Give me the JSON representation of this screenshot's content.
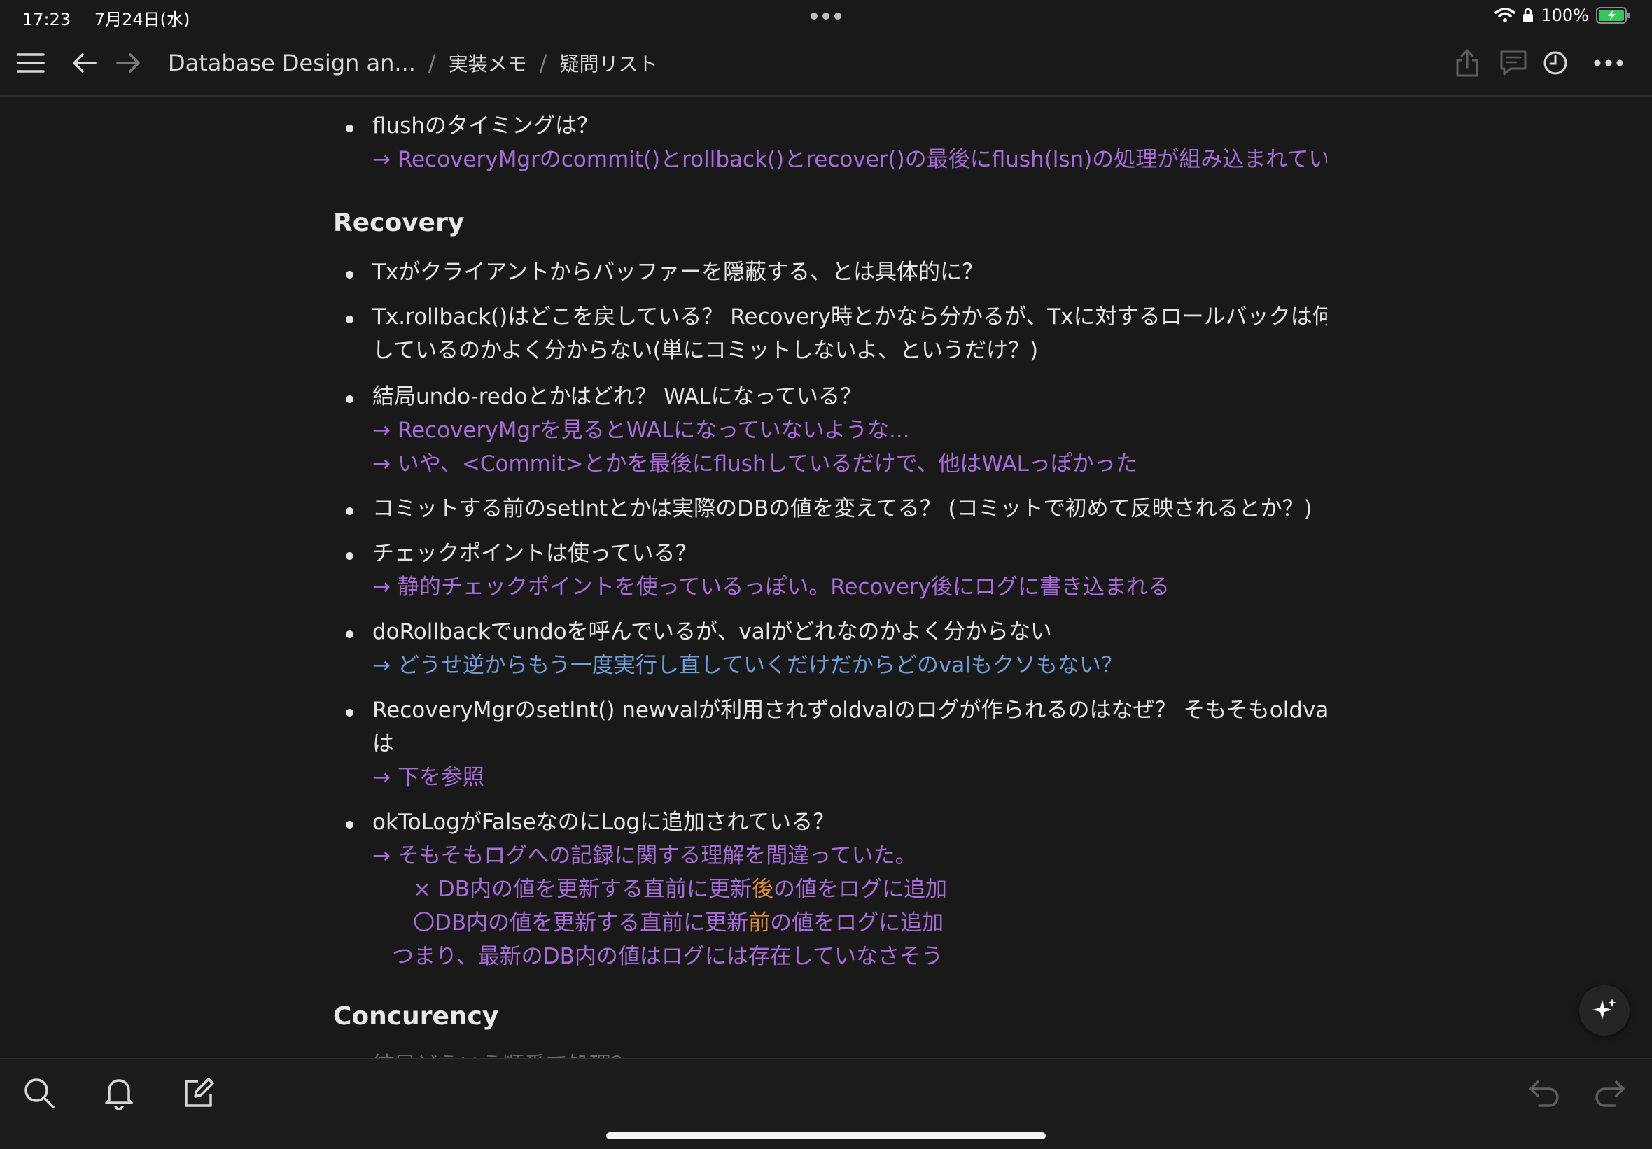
{
  "status_bar": {
    "time": "17:23",
    "date": "7月24日(水)",
    "battery": "100%"
  },
  "breadcrumb": {
    "root": "Database Design an...",
    "sep1": "/",
    "parent": "実装メモ",
    "sep2": "/",
    "current": "疑問リスト"
  },
  "content": {
    "items": [
      {
        "id": "l1",
        "kind": "bullet",
        "text": "flushのタイミングは？"
      },
      {
        "id": "l2",
        "kind": "answer",
        "text": "→ RecoveryMgrのcommit()とrollback()とrecover()の最後にflush(lsn)の処理が組み込まれている"
      },
      {
        "id": "h1",
        "kind": "heading",
        "text": "Recovery"
      },
      {
        "id": "l3",
        "kind": "bullet",
        "text": "Txがクライアントからバッファーを隠蔽する、とは具体的に？"
      },
      {
        "id": "l4",
        "kind": "bullet",
        "text": "Tx.rollback()はどこを戻している？ Recovery時とかなら分かるが、Txに対するロールバックは何を"
      },
      {
        "id": "l5",
        "kind": "cont",
        "text": "しているのかよく分からない(単にコミットしないよ、というだけ？)"
      },
      {
        "id": "l6",
        "kind": "bullet",
        "text": "結局undo-redoとかはどれ？ WALになっている？"
      },
      {
        "id": "l7",
        "kind": "answer",
        "text": "→ RecoveryMgrを見るとWALになっていないような..."
      },
      {
        "id": "l8",
        "kind": "answer",
        "text": "→ いや、<Commit>とかを最後にflushしているだけで、他はWALっぽかった"
      },
      {
        "id": "l9",
        "kind": "bullet",
        "text": "コミットする前のsetIntとかは実際のDBの値を変えてる？ (コミットで初めて反映されるとか？)"
      },
      {
        "id": "l10",
        "kind": "bullet",
        "text": "チェックポイントは使っている？"
      },
      {
        "id": "l11",
        "kind": "answer",
        "text": "→ 静的チェックポイントを使っているっぽい。Recovery後にログに書き込まれる"
      },
      {
        "id": "l12",
        "kind": "bullet",
        "text": "doRollbackでundoを呼んでいるが、valがどれなのかよく分からない"
      },
      {
        "id": "l13",
        "kind": "answer-blue",
        "text": "→ どうせ逆からもう一度実行し直していくだけだからどのvalもクソもない？"
      },
      {
        "id": "l14",
        "kind": "bullet",
        "text": "RecoveryMgrのsetInt() newvalが利用されずoldvalのログが作られるのはなぜ？ そもそもoldvalと"
      },
      {
        "id": "l15",
        "kind": "cont",
        "text": "は"
      },
      {
        "id": "l16",
        "kind": "answer",
        "text": "→ 下を参照"
      },
      {
        "id": "l17",
        "kind": "bullet",
        "text": "okToLogがFalseなのにLogに追加されている？"
      },
      {
        "id": "l18",
        "kind": "answer",
        "text": "→ そもそもログへの記録に関する理解を間違っていた。"
      },
      {
        "id": "l19",
        "kind": "answer2",
        "pre": "× DB内の値を更新する直前に更新",
        "hl": "後",
        "post": "の値をログに追加"
      },
      {
        "id": "l20",
        "kind": "answer2",
        "pre": "〇DB内の値を更新する直前に更新",
        "hl": "前",
        "post": "の値をログに追加"
      },
      {
        "id": "l21",
        "kind": "answer3",
        "text": "つまり、最新のDB内の値はログには存在していなさそう"
      },
      {
        "id": "h2",
        "kind": "heading",
        "text": "Concurency"
      },
      {
        "id": "l22",
        "kind": "bullet-fade",
        "text": "結局どういう順番で処理？"
      }
    ]
  },
  "colors": {
    "background": "#191919",
    "text": "#e4e4e4",
    "answer_purple": "#a66bd8",
    "answer_blue": "#6e9bd9",
    "highlight_orange": "#e08a32"
  },
  "icons": [
    "hamburger-icon",
    "back-arrow-icon",
    "forward-arrow-icon",
    "share-icon",
    "comment-icon",
    "clock-icon",
    "more-icon",
    "search-icon",
    "bell-icon",
    "compose-icon",
    "undo-icon",
    "redo-icon",
    "sparkle-icon",
    "wifi-icon",
    "lock-icon",
    "battery-icon"
  ]
}
